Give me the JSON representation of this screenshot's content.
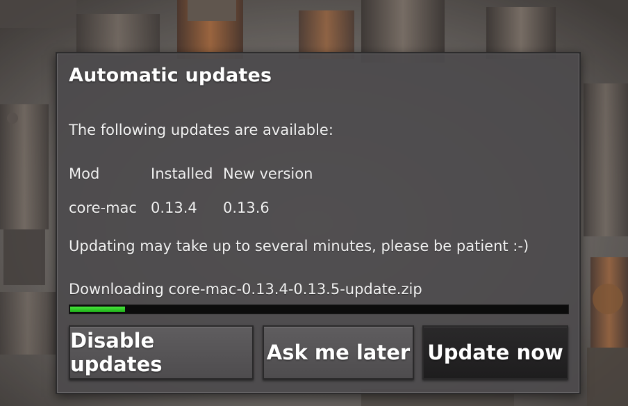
{
  "dialog": {
    "title": "Automatic updates",
    "intro": "The following updates are available:",
    "table": {
      "headers": [
        "Mod",
        "Installed",
        "New version"
      ],
      "rows": [
        [
          "core-mac",
          "0.13.4",
          "0.13.6"
        ]
      ]
    },
    "patience_note": "Updating may take up to several minutes, please be patient :-)",
    "download_status": "Downloading core-mac-0.13.4-0.13.5-update.zip",
    "progress_fraction": 0.11,
    "buttons": {
      "disable": "Disable updates",
      "later": "Ask me later",
      "update": "Update now"
    }
  },
  "colors": {
    "progress_fill": "#2ecc27",
    "panel": "#4c4a4c",
    "primary_button": "#1e1d1e"
  }
}
